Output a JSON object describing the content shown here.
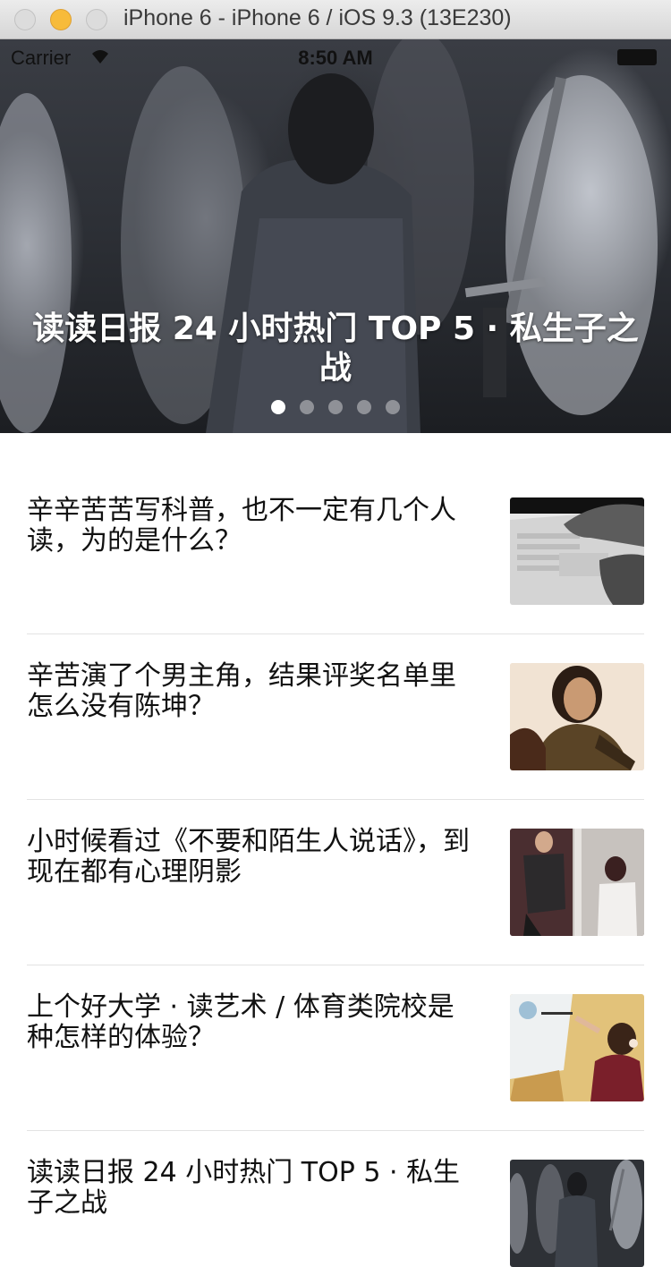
{
  "window": {
    "title": "iPhone 6 - iPhone 6 / iOS 9.3 (13E230)"
  },
  "status_bar": {
    "carrier": "Carrier",
    "time": "8:50 AM",
    "wifi_icon": "wifi-icon",
    "battery_icon": "battery-icon"
  },
  "hero": {
    "title": "读读日报 24 小时热门 TOP 5 · 私生子之战",
    "page_count": 5,
    "current_page": 1
  },
  "articles": [
    {
      "title": "辛辛苦苦写科普，也不一定有几个人读，为的是什么？",
      "thumbnail": "laptop-hands-photo"
    },
    {
      "title": "辛苦演了个男主角，结果评奖名单里怎么没有陈坤？",
      "thumbnail": "actor-portrait-photo"
    },
    {
      "title": "小时候看过《不要和陌生人说话》，到现在都有心理阴影",
      "thumbnail": "drama-scene-photo"
    },
    {
      "title": "上个好大学 · 读艺术 / 体育类院校是种怎样的体验？",
      "thumbnail": "painting-child-photo"
    },
    {
      "title": "读读日报 24 小时热门 TOP 5 · 私生子之战",
      "thumbnail": "knight-horses-photo"
    }
  ],
  "colors": {
    "accent_traffic_yellow": "#f7bb3a",
    "text": "#111111",
    "divider": "#e3e3e3"
  }
}
